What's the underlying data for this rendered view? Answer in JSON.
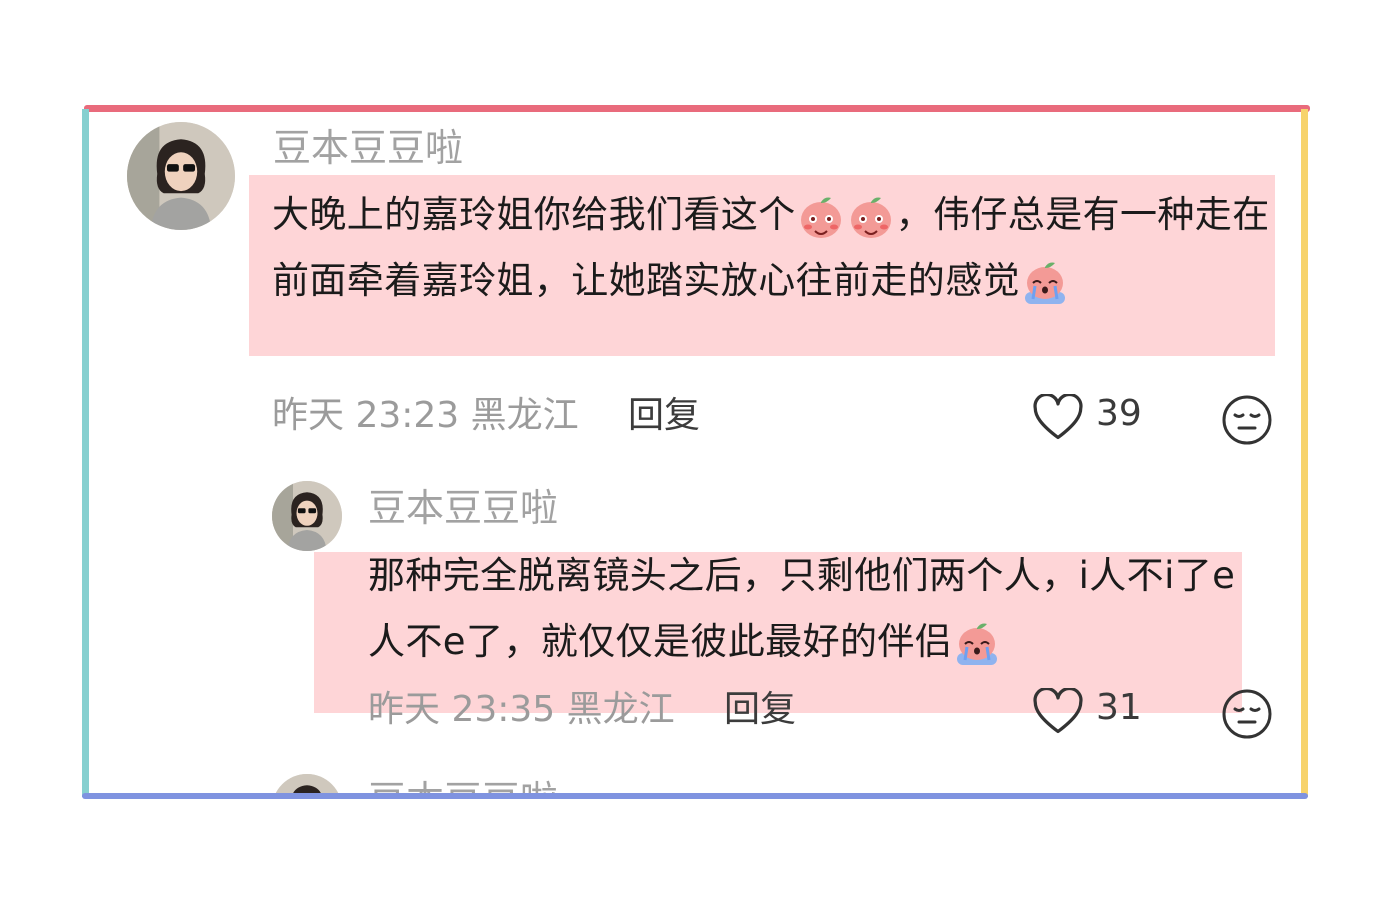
{
  "comments": [
    {
      "username": "豆本豆豆啦",
      "text_part1": "大晚上的嘉玲姐你给我们看这个",
      "text_part2": "，伟仔总是有一种走在前面牵着嘉玲姐，让她踏实放心往前走的感觉",
      "emojis": [
        "blush-peach-emoji",
        "blush-peach-emoji",
        "crying-peach-emoji"
      ],
      "time": "昨天 23:23",
      "location": "黑龙江",
      "reply_label": "回复",
      "likes": "39"
    },
    {
      "username": "豆本豆豆啦",
      "text": "那种完全脱离镜头之后，只剩他们两个人，i人不i了e人不e了，就仅仅是彼此最好的伴侣",
      "emojis": [
        "crying-peach-emoji"
      ],
      "time": "昨天 23:35",
      "location": "黑龙江",
      "reply_label": "回复",
      "likes": "31"
    }
  ],
  "partial_comment": {
    "username": "豆本豆豆啦"
  },
  "colors": {
    "frame_top": "#e96b7c",
    "frame_bottom": "#7f93e0",
    "frame_left": "#86d0d0",
    "frame_right": "#f7d36c",
    "highlight": "#fed5d7"
  }
}
